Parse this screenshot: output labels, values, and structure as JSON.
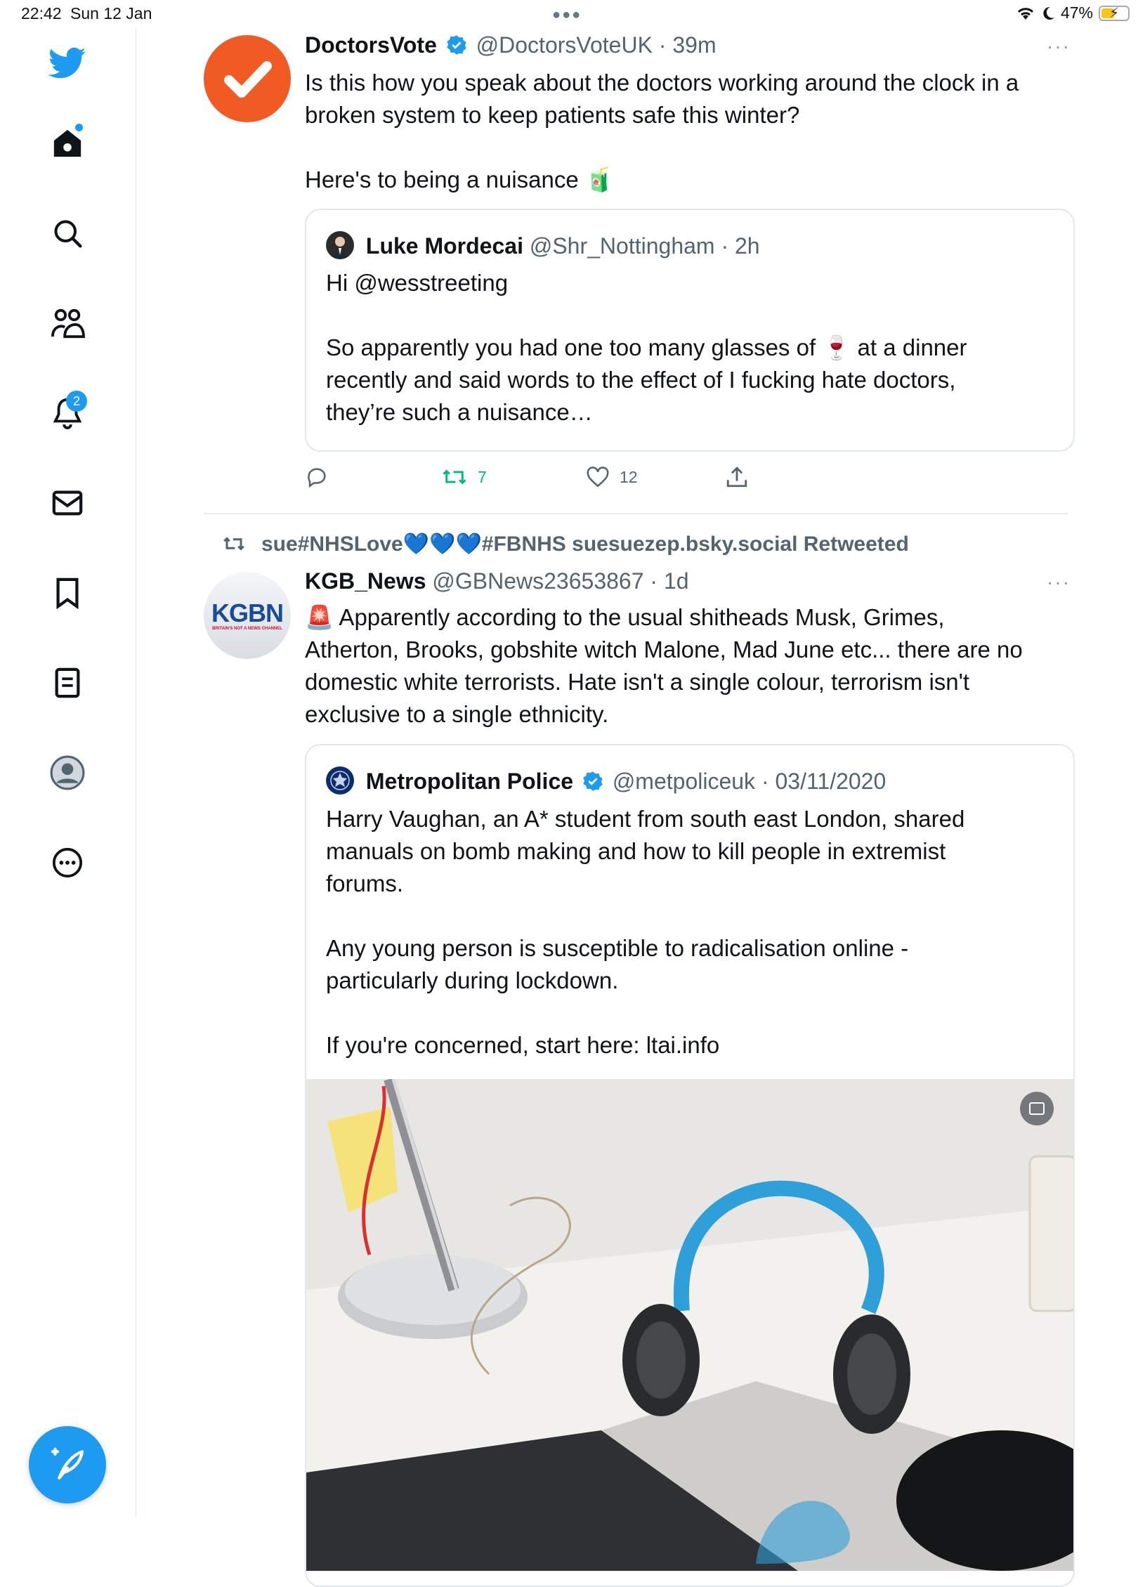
{
  "status_bar": {
    "time": "22:42",
    "date": "Sun 12 Jan",
    "battery": "47%"
  },
  "sidebar": {
    "notification_count": "2"
  },
  "tweet1": {
    "name": "DoctorsVote",
    "handle": "@DoctorsVoteUK",
    "time": "39m",
    "text_line1": "Is this how you speak about the doctors working around the clock in a",
    "text_line2": "broken system to keep patients safe this winter?",
    "text_line3": "Here's to being a nuisance 🧃",
    "quote": {
      "name": "Luke Mordecai",
      "handle": "@Shr_Nottingham",
      "time": "2h",
      "line1": "Hi @wesstreeting",
      "line2": "So apparently you had one too many glasses of 🍷 at a dinner",
      "line3": "recently and said words to the effect of I fucking hate doctors,",
      "line4": "they’re such a nuisance…"
    },
    "retweets": "7",
    "likes": "12"
  },
  "retweet_banner": "sue#NHSLove💙💙💙#FBNHS suesuezep.bsky.social Retweeted",
  "tweet2": {
    "name": "KGB_News",
    "handle": "@GBNews23653867",
    "time": "1d",
    "avatar_text": "KGBN",
    "avatar_subtext": "BRITAIN'S NOT A NEWS CHANNEL",
    "text_line1": "🚨 Apparently according to the usual shitheads Musk, Grimes,",
    "text_line2": "Atherton, Brooks, gobshite witch Malone, Mad June etc... there are no",
    "text_line3": "domestic white terrorists. Hate isn't a single colour, terrorism isn't",
    "text_line4": "exclusive to a single ethnicity.",
    "quote": {
      "name": "Metropolitan Police",
      "handle": "@metpoliceuk",
      "time": "03/11/2020",
      "line1": "Harry Vaughan, an A* student from south east London, shared",
      "line2": "manuals on bomb making and how to kill people in extremist",
      "line3": "forums.",
      "line4": "Any young person is susceptible to radicalisation online -",
      "line5": "particularly during lockdown.",
      "line6": "If you're concerned, start here: ltai.info"
    }
  },
  "colors": {
    "accent": "#1d9bf0",
    "retweet_green": "#00ba7c",
    "doctorsvote_orange": "#f05a23"
  }
}
